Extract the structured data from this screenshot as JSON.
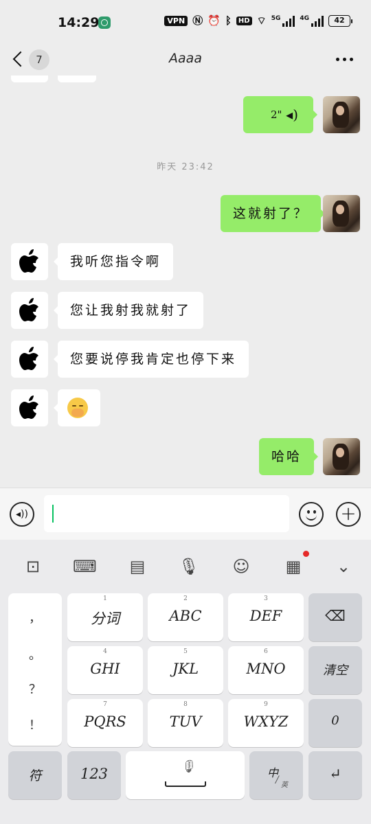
{
  "status_bar": {
    "time": "14:29",
    "vpn": "VPN",
    "hd": "HD",
    "net_5g": "5G",
    "net_4g": "4G",
    "battery": "42"
  },
  "header": {
    "unread_count": "7",
    "title": "Aaaa"
  },
  "chat": {
    "messages": [
      {
        "side": "out",
        "type": "voice",
        "duration": "2\""
      },
      {
        "side": "out",
        "type": "text",
        "text": "这就射了？"
      },
      {
        "side": "in",
        "type": "text",
        "text": "我听您指令啊"
      },
      {
        "side": "in",
        "type": "text",
        "text": "您让我射我就射了"
      },
      {
        "side": "in",
        "type": "text",
        "text": "您要说停我肯定也停下来"
      },
      {
        "side": "in",
        "type": "emoji",
        "emoji": "face-with-hand-over-mouth"
      },
      {
        "side": "out",
        "type": "text",
        "text": "哈哈"
      }
    ],
    "timestamp": "昨天 23:42"
  },
  "input": {
    "value": ""
  },
  "keyboard": {
    "toolbar": [
      "toolbox-icon",
      "keyboard-icon",
      "clipboard-icon",
      "mic-icon",
      "emoji-icon",
      "grid-apps-icon",
      "collapse-icon"
    ],
    "punctuation": [
      "，",
      "。",
      "？",
      "！"
    ],
    "rows": [
      [
        {
          "num": "1",
          "label": "分词"
        },
        {
          "num": "2",
          "label": "ABC"
        },
        {
          "num": "3",
          "label": "DEF"
        }
      ],
      [
        {
          "num": "4",
          "label": "GHI"
        },
        {
          "num": "5",
          "label": "JKL"
        },
        {
          "num": "6",
          "label": "MNO"
        }
      ],
      [
        {
          "num": "7",
          "label": "PQRS"
        },
        {
          "num": "8",
          "label": "TUV"
        },
        {
          "num": "9",
          "label": "WXYZ"
        }
      ]
    ],
    "clear_label": "清空",
    "zero_label": "0",
    "symbol_label": "符",
    "numbers_label": "123",
    "lang_main": "中",
    "lang_alt": "英",
    "accent": "#95ec69"
  }
}
